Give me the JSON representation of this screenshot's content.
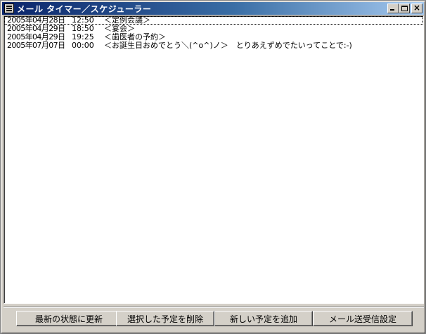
{
  "window": {
    "title": "メール タイマー／スケジューラー"
  },
  "schedule": {
    "items": [
      {
        "date": "2005年04月28日",
        "time": "12:50",
        "subject": "＜定例会議＞"
      },
      {
        "date": "2005年04月29日",
        "time": "18:50",
        "subject": "＜宴会＞"
      },
      {
        "date": "2005年04月29日",
        "time": "19:25",
        "subject": "＜歯医者の予約＞"
      },
      {
        "date": "2005年07月07日",
        "time": "00:00",
        "subject": "＜お誕生日おめでとう＼(^o^)ノ＞　とりあえずめでたいってことで:-)"
      }
    ]
  },
  "buttons": {
    "refresh": "最新の状態に更新",
    "delete_selected": "選択した予定を削除",
    "add_new": "新しい予定を追加",
    "mail_settings": "メール送受信設定"
  }
}
